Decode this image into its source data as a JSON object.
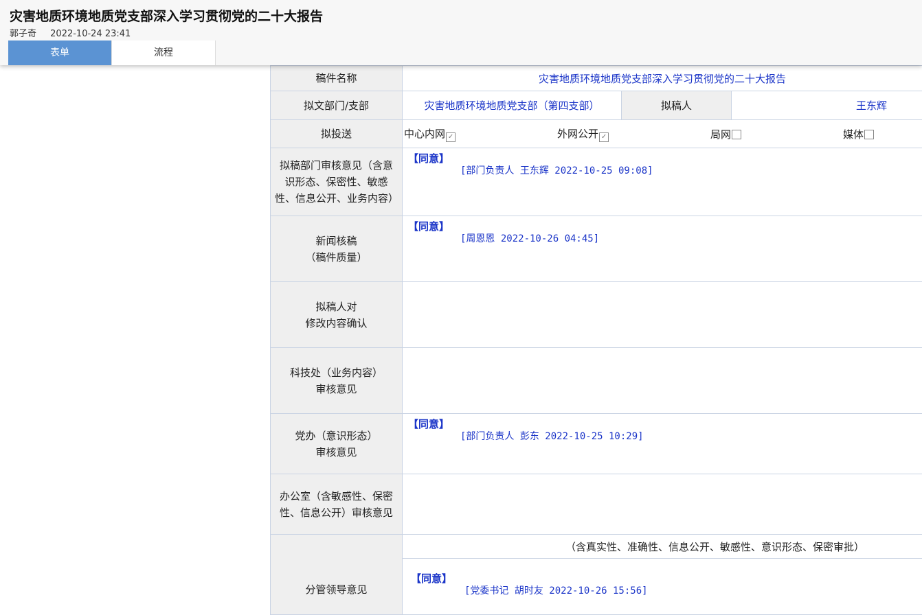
{
  "header": {
    "title": "灾害地质环境地质党支部深入学习贯彻党的二十大报告",
    "author": "郭子奇",
    "date": "2022-10-24 23:41"
  },
  "tabs": [
    {
      "label": "表单",
      "active": true
    },
    {
      "label": "流程",
      "active": false
    }
  ],
  "form": {
    "manuscript_name_label": "稿件名称",
    "manuscript_name": "灾害地质环境地质党支部深入学习贯彻党的二十大报告",
    "dept_label": "拟文部门/支部",
    "dept": "灾害地质环境地质党支部（第四支部）",
    "author_label": "拟稿人",
    "author": "王东辉",
    "send_label": "拟投送",
    "send_options": [
      {
        "label": "中心内网",
        "checked": true
      },
      {
        "label": "外网公开",
        "checked": true
      },
      {
        "label": "局网",
        "checked": false
      },
      {
        "label": "媒体",
        "checked": false
      }
    ],
    "dept_review_label": "拟稿部门审核意见（含意识形态、保密性、敏感性、信息公开、业务内容）",
    "dept_review_agree": "【同意】",
    "dept_review_sig": "[部门负责人 王东辉 2022-10-25 09:08]",
    "news_review_label_1": "新闻核稿",
    "news_review_label_2": "（稿件质量）",
    "news_review_agree": "【同意】",
    "news_review_sig": "[周恩恩 2022-10-26 04:45]",
    "author_confirm_label_1": "拟稿人对",
    "author_confirm_label_2": "修改内容确认",
    "tech_review_label_1": "科技处（业务内容）",
    "tech_review_label_2": "审核意见",
    "party_review_label_1": "党办（意识形态）",
    "party_review_label_2": "审核意见",
    "party_review_agree": "【同意】",
    "party_review_sig": "[部门负责人 彭东 2022-10-25 10:29]",
    "office_review_label": "办公室（含敏感性、保密性、信息公开）审核意见",
    "leader_label": "分管领导意见",
    "leader_note": "（含真实性、准确性、信息公开、敏感性、意识形态、保密审批）",
    "leader_agree": "【同意】",
    "leader_sig": "[党委书记 胡时友 2022-10-26 15:56]"
  }
}
